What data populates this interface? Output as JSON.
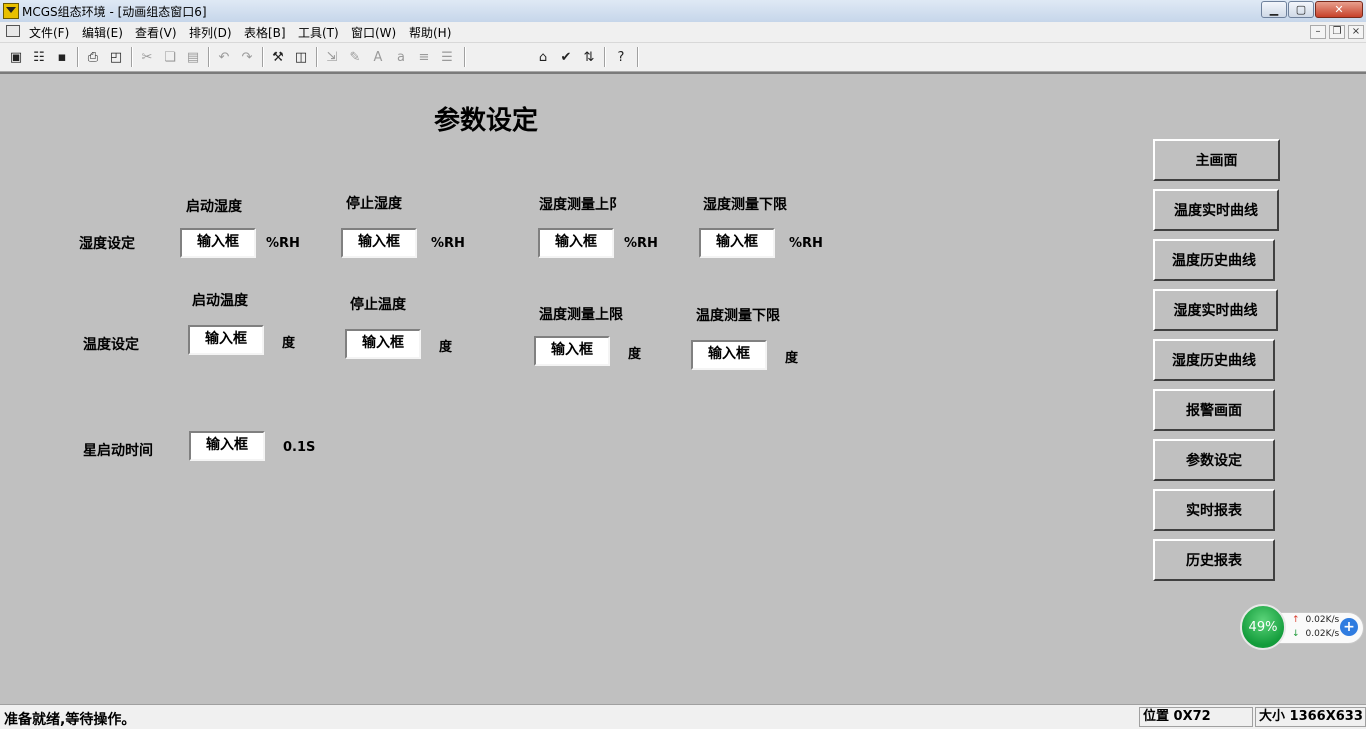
{
  "window": {
    "title": "MCGS组态环境 - [动画组态窗口6]",
    "min_symbol": "▁",
    "max_symbol": "▢",
    "close_symbol": "✕"
  },
  "menu": {
    "items": [
      "文件(F)",
      "编辑(E)",
      "查看(V)",
      "排列(D)",
      "表格[B]",
      "工具(T)",
      "窗口(W)",
      "帮助(H)"
    ],
    "mdi_min": "–",
    "mdi_restore": "❐",
    "mdi_close": "×"
  },
  "toolbar": {
    "icons": [
      "window-icon",
      "properties-icon",
      "save-icon",
      "print-icon",
      "print-preview-icon",
      "cut-icon",
      "copy-icon",
      "paste-icon",
      "undo-icon",
      "redo-icon",
      "tools-icon",
      "frame-icon",
      "align-icon",
      "edit-icon",
      "font-icon",
      "text-icon",
      "list-icon",
      "indent-icon",
      "object-props-icon",
      "check-icon",
      "sort-icon",
      "help-icon"
    ]
  },
  "page": {
    "title": "参数设定",
    "input_placeholder_text": "输入框",
    "humidity": {
      "row_label": "湿度设定",
      "headers": [
        "启动湿度",
        "停止湿度",
        "湿度测量上限",
        "湿度测量下限"
      ],
      "header3_visible": "湿度测量上阝",
      "unit": "%RH"
    },
    "temperature": {
      "row_label": "温度设定",
      "headers": [
        "启动温度",
        "停止温度",
        "温度测量上限",
        "温度测量下限"
      ],
      "unit": "度"
    },
    "star": {
      "row_label": "星启动时间",
      "unit": "0.1S"
    }
  },
  "nav": {
    "buttons": [
      "主画面",
      "温度实时曲线",
      "温度历史曲线",
      "湿度实时曲线",
      "湿度历史曲线",
      "报警画面",
      "参数设定",
      "实时报表",
      "历史报表"
    ]
  },
  "netwidget": {
    "percent": "49%",
    "up": "0.02K/s",
    "down": "0.02K/s",
    "up_color": "#d83a2a",
    "down_color": "#1f9a3a"
  },
  "statusbar": {
    "message": "准备就绪,等待操作。",
    "position": "位置 0X72",
    "size": "大小 1366X633"
  }
}
